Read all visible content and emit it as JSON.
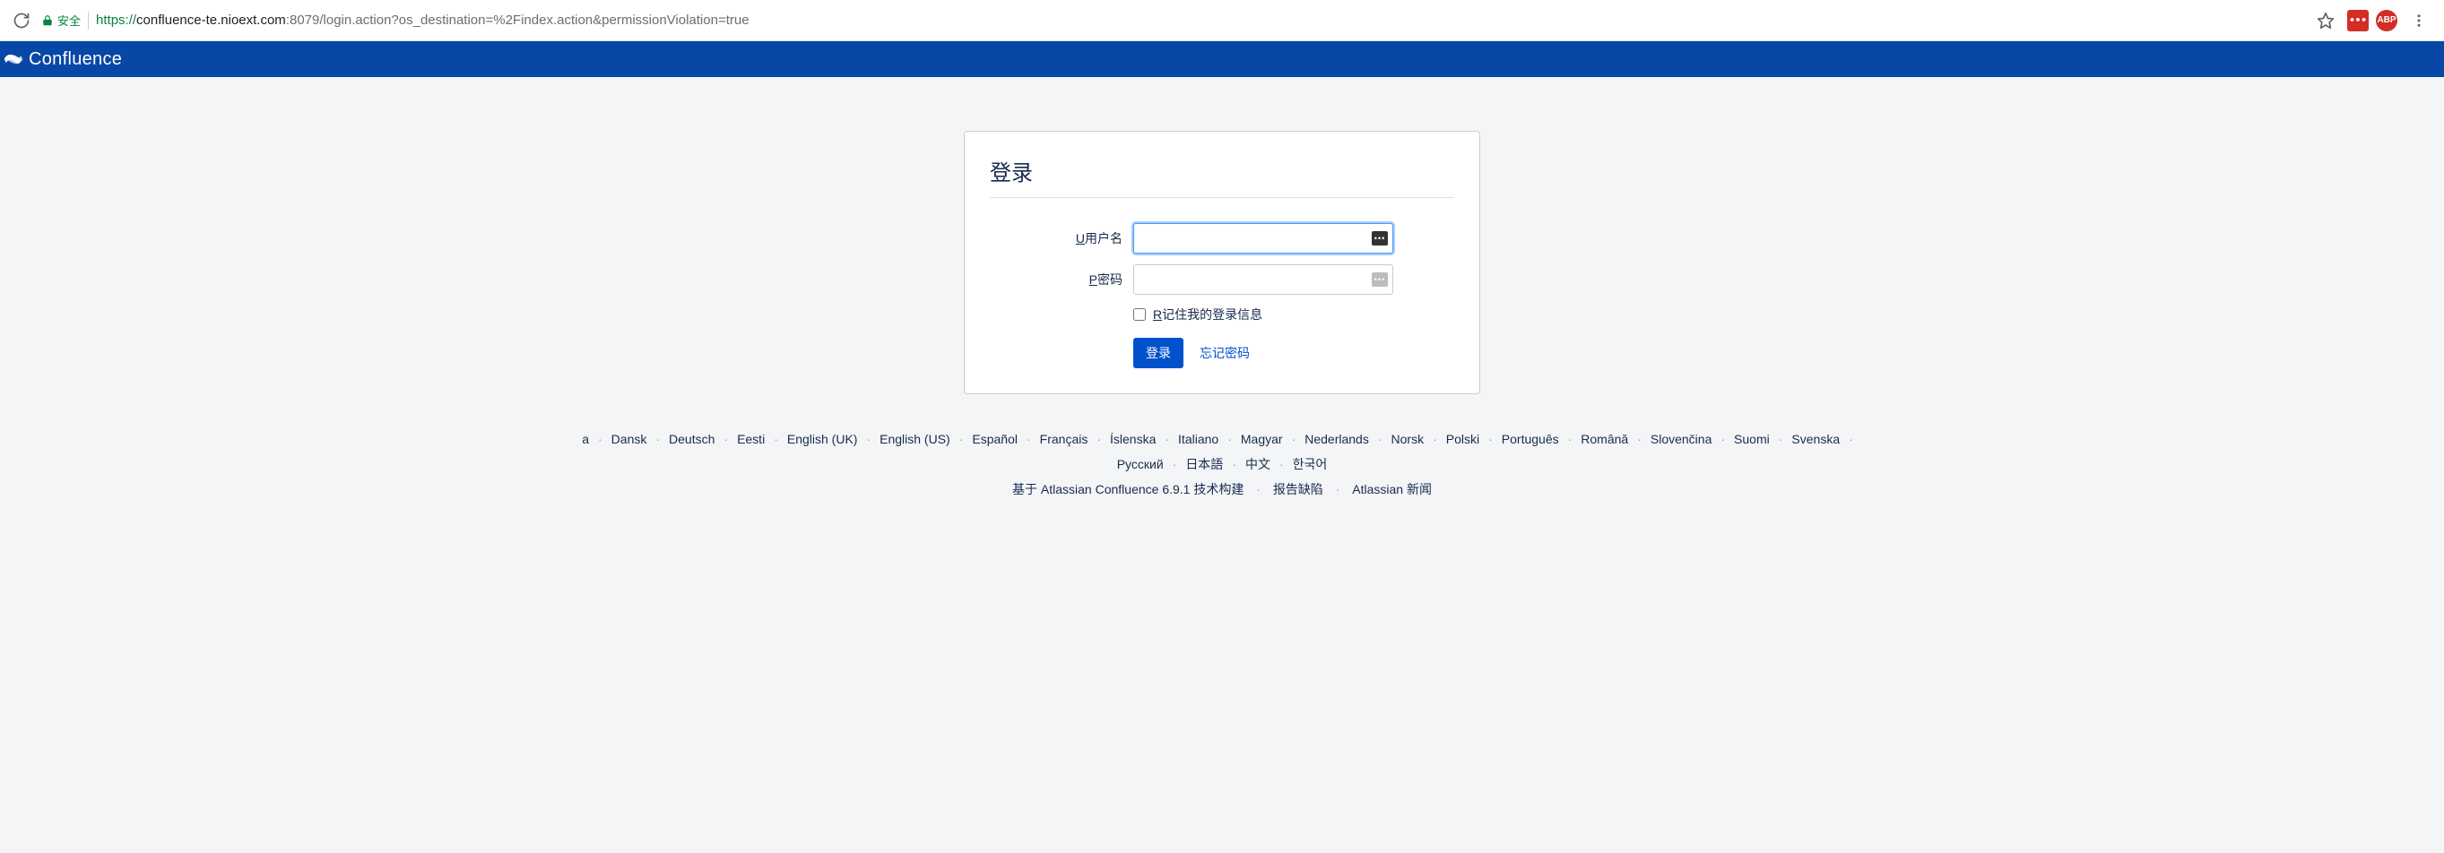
{
  "browser": {
    "secure_label": "安全",
    "url_scheme": "https://",
    "url_host": "confluence-te.nioext.com",
    "url_port": ":8079",
    "url_path": "/login.action?os_destination=%2Findex.action&permissionViolation=true",
    "ext_lastpass": "•••",
    "ext_abp": "ABP"
  },
  "header": {
    "product_name": "Confluence"
  },
  "login": {
    "title": "登录",
    "username_label_u": "U",
    "username_label_rest": "用户名",
    "username_value": "",
    "password_label_u": "P",
    "password_label_rest": "密码",
    "password_value": "",
    "remember_u": "R",
    "remember_rest": "记住我的登录信息",
    "submit_label": "登录",
    "forgot_label": "忘记密码"
  },
  "footer": {
    "languages_row1_leading_fragment": "a",
    "languages": [
      "Dansk",
      "Deutsch",
      "Eesti",
      "English (UK)",
      "English (US)",
      "Español",
      "Français",
      "Íslenska",
      "Italiano",
      "Magyar",
      "Nederlands",
      "Norsk",
      "Polski",
      "Português",
      "Română",
      "Slovenčina",
      "Suomi",
      "Svenska"
    ],
    "languages_row2": [
      "Русский",
      "日本語",
      "中文",
      "한국어"
    ],
    "meta_built": "基于 Atlassian Confluence 6.9.1 技术构建",
    "meta_report": "报告缺陷",
    "meta_news": "Atlassian 新闻"
  }
}
